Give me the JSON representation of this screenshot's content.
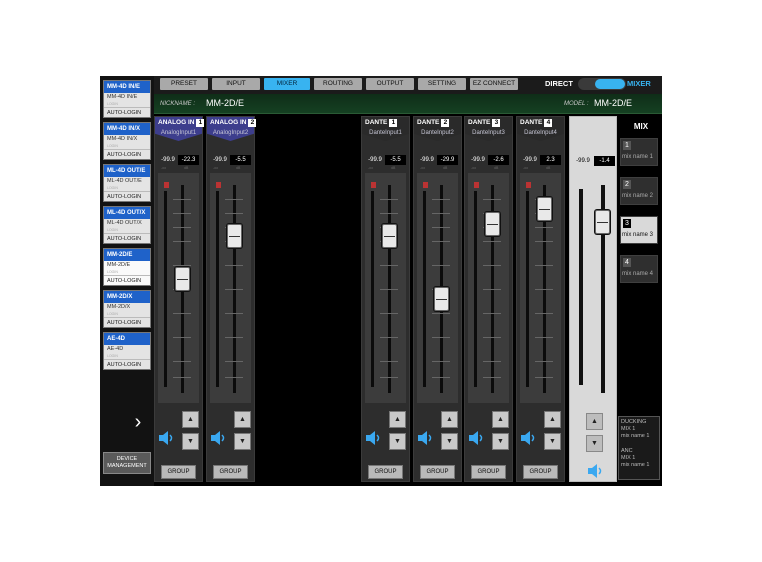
{
  "devices": [
    {
      "name": "MM-4D IN/E",
      "model": "MM-4D IN/E",
      "login": "LOGIN",
      "auto": "AUTO-LOGIN"
    },
    {
      "name": "MM-4D IN/X",
      "model": "MM-4D IN/X",
      "login": "LOGIN",
      "auto": "AUTO-LOGIN"
    },
    {
      "name": "ML-4D OUT/E",
      "model": "ML-4D OUT/E",
      "login": "LOGIN",
      "auto": "AUTO-LOGIN"
    },
    {
      "name": "ML-4D OUT/X",
      "model": "ML-4D OUT/X",
      "login": "LOGIN",
      "auto": "AUTO-LOGIN"
    },
    {
      "name": "MM-2D/E",
      "model": "MM-2D/E",
      "login": "LOGIN",
      "auto": "AUTO-LOGIN"
    },
    {
      "name": "MM-2D/X",
      "model": "MM-2D/X",
      "login": "LOGIN",
      "auto": "AUTO-LOGIN"
    },
    {
      "name": "AE-4D",
      "model": "AE-4D",
      "login": "LOGIN",
      "auto": "AUTO-LOGIN"
    }
  ],
  "next_arrow": "›",
  "device_management": "DEVICE MANAGEMENT",
  "tabs": [
    "PRESET",
    "INPUT",
    "MIXER",
    "ROUTING",
    "OUTPUT",
    "SETTING",
    "EZ CONNECT"
  ],
  "active_tab": "MIXER",
  "mode": {
    "direct": "DIRECT",
    "mixer": "MIXER",
    "selected": "MIXER"
  },
  "nickname_label": "NICKNAME :",
  "nickname": "MM-2D/E",
  "model_label": "MODEL :",
  "model": "MM-2D/E",
  "channels": [
    {
      "name": "ANALOG IN",
      "num": "1",
      "input": "AnalogInput1",
      "v1": "-99.9",
      "v2": "-22.3",
      "level": 0.58,
      "group": "GROUP"
    },
    {
      "name": "ANALOG IN",
      "num": "2",
      "input": "AnalogInput2",
      "v1": "-99.9",
      "v2": "-5.5",
      "level": 0.8,
      "group": "GROUP"
    },
    {
      "name": "DANTE",
      "num": "1",
      "input": "DanteInput1",
      "v1": "-99.9",
      "v2": "-5.5",
      "level": 0.8,
      "group": "GROUP"
    },
    {
      "name": "DANTE",
      "num": "2",
      "input": "DanteInput2",
      "v1": "-99.9",
      "v2": "-29.9",
      "level": 0.48,
      "group": "GROUP"
    },
    {
      "name": "DANTE",
      "num": "3",
      "input": "DanteInput3",
      "v1": "-99.9",
      "v2": "-2.6",
      "level": 0.86,
      "group": "GROUP"
    },
    {
      "name": "DANTE",
      "num": "4",
      "input": "DanteInput4",
      "v1": "-99.9",
      "v2": "2.3",
      "level": 0.94,
      "group": "GROUP"
    }
  ],
  "vu_marks": {
    "left": "-oo",
    "right": "dB"
  },
  "master": {
    "v1": "-99.9",
    "v2": "-1.4",
    "level": 0.87
  },
  "mix_title": "MIX",
  "mixes": [
    {
      "num": "1",
      "name": "mix name 1"
    },
    {
      "num": "2",
      "name": "mix name 2"
    },
    {
      "num": "3",
      "name": "mix name 3"
    },
    {
      "num": "4",
      "name": "mix name 4"
    }
  ],
  "selected_mix": "3",
  "status": {
    "ducking_title": "DUCKING",
    "ducking_mix": "MIX 1",
    "ducking_name": "mix name 1",
    "anc_title": "ANC",
    "anc_mix": "MIX 1",
    "anc_name": "mix name 1"
  },
  "colors": {
    "accent": "#38b3f0",
    "device_header": "#1f62c9",
    "analog_header": "#3d3e8d",
    "dante_header": "#2a2a2a",
    "speaker": "#3aa8f0"
  }
}
